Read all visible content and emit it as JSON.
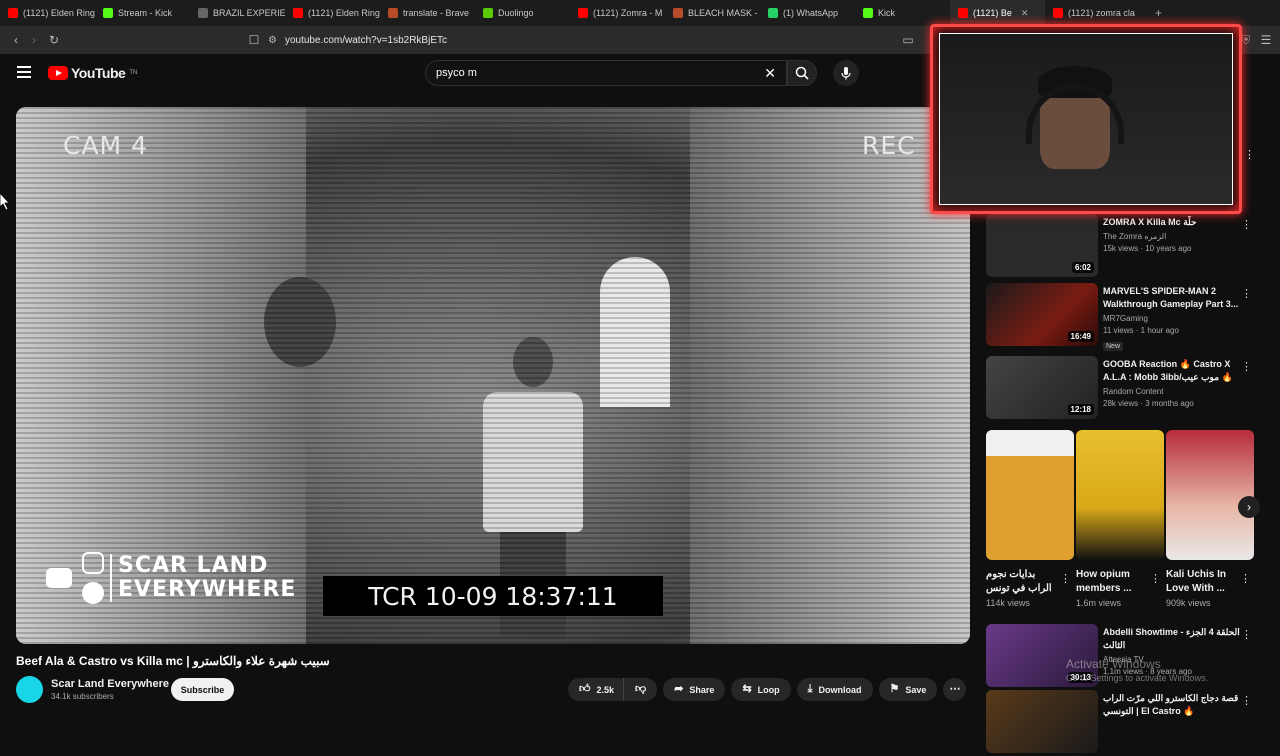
{
  "browser": {
    "tabs": [
      {
        "label": "(1121) Elden Ring",
        "color": "#ff0000"
      },
      {
        "label": "Stream - Kick",
        "color": "#53fc18"
      },
      {
        "label": "BRAZIL EXPERIEN",
        "color": "#666666"
      },
      {
        "label": "(1121) Elden Ring",
        "color": "#ff0000"
      },
      {
        "label": "translate - Brave",
        "color": "#b84c2a"
      },
      {
        "label": "Duolingo",
        "color": "#58cc02"
      },
      {
        "label": "(1121) Zomra - M",
        "color": "#ff0000"
      },
      {
        "label": "BLEACH MASK - ",
        "color": "#b84c2a"
      },
      {
        "label": "(1) WhatsApp",
        "color": "#25d366"
      },
      {
        "label": "Kick",
        "color": "#53fc18"
      },
      {
        "label": "(1121) Be",
        "color": "#ff0000",
        "active": true
      },
      {
        "label": "(1121) zomra cla",
        "color": "#ff0000"
      }
    ],
    "url": "youtube.com/watch?v=1sb2RkBjETc"
  },
  "youtube": {
    "logo_text": "YouTube",
    "logo_country": "TN",
    "search_value": "psyco m"
  },
  "video": {
    "overlay_cam": "CAM 4",
    "overlay_rec": "REC",
    "overlay_tcr": "TCR 10-09 18:37:11",
    "brand_line1": "SCAR LAND",
    "brand_line2": "EVERYWHERE",
    "title": "Beef Ala & Castro vs Killa mc | سبيب شهرة علاء والكاسترو",
    "channel": "Scar Land Everywhere",
    "subscribers": "34.1k subscribers",
    "subscribe_label": "Subscribe",
    "likes": "2.5k",
    "share_label": "Share",
    "loop_label": "Loop",
    "download_label": "Download",
    "save_label": "Save"
  },
  "recommendations": [
    {
      "title": "ZOMRA X Killa Mc حلّة",
      "channel": "The Zomra الزمره",
      "views": "15k views · 10 years ago",
      "duration": "6:02",
      "thumb": "#2a2a2a"
    },
    {
      "title": "MARVEL'S SPIDER-MAN 2 Walkthrough Gameplay Part 3...",
      "channel": "MR7Gaming",
      "views": "11 views · 1 hour ago",
      "duration": "16:49",
      "badge": "New",
      "thumb": "#5a1a12"
    },
    {
      "title": "GOOBA Reaction 🔥 Castro X A.L.A : Mobb 3ibb/موب عيب 🔥",
      "channel": "Random Content",
      "views": "28k views · 3 months ago",
      "duration": "12:18",
      "thumb": "#3a3a3a"
    }
  ],
  "shorts": [
    {
      "title": "بدايات نجوم الراب في تونس | الجزء",
      "views": "114k views",
      "thumb": "#d89a2a"
    },
    {
      "title": "How opium members ...",
      "views": "1.6m views",
      "thumb": "#c8a21a"
    },
    {
      "title": "Kali Uchis In Love With ...",
      "views": "909k views",
      "thumb": "#a83a4a"
    }
  ],
  "recommendations_lower": [
    {
      "title": "Abdelli Showtime - الحلقة 4 الجزء الثالث",
      "channel": "Attessia TV",
      "views": "1.1m views · 8 years ago",
      "duration": "30:13",
      "thumb": "#3a2a4a"
    },
    {
      "title": "قصة دجاج الكاسترو اللي مرّت الراب التونسي | El Castro 🔥",
      "thumb": "#4a3a2a"
    }
  ],
  "windows_watermark": {
    "line1": "Activate Windows",
    "line2": "Go to Settings to activate Windows."
  }
}
